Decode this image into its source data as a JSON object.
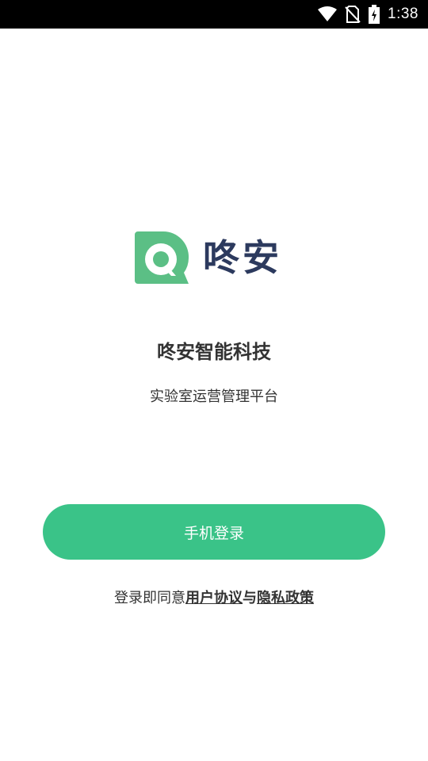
{
  "status_bar": {
    "time": "1:38",
    "icons": [
      "wifi-icon",
      "no-sim-icon",
      "battery-charging-icon"
    ]
  },
  "brand": {
    "logo_text": "咚安",
    "company_name": "咚安智能科技",
    "subtitle": "实验室运营管理平台",
    "colors": {
      "green": "#3ac388",
      "navy": "#2c3a5e",
      "logo_green": "#5bbf85"
    }
  },
  "login": {
    "button_label": "手机登录"
  },
  "agreement": {
    "prefix": "登录即同意",
    "user_agreement": "用户协议",
    "joiner": "与",
    "privacy_policy": "隐私政策"
  }
}
